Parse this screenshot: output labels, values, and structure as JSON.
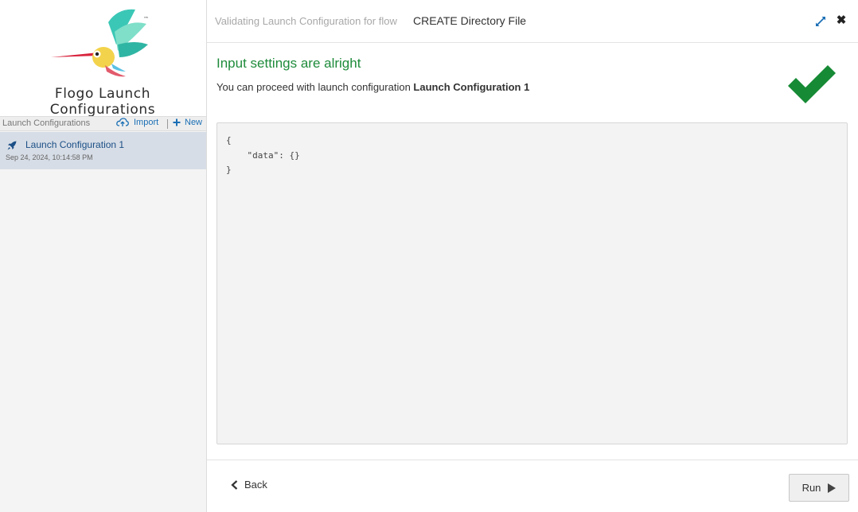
{
  "sidebar": {
    "app_title": "Flogo Launch Configurations",
    "list_header": "Launch Configurations",
    "import_label": "Import",
    "new_label": "New",
    "items": [
      {
        "name": "Launch Configuration 1",
        "date": "Sep 24, 2024, 10:14:58 PM",
        "icon": "rocket-icon"
      }
    ]
  },
  "header": {
    "prefix": "Validating Launch Configuration for flow",
    "flow_name": "CREATE Directory File"
  },
  "status": {
    "title": "Input settings are alright",
    "message_prefix": "You can proceed with launch configuration ",
    "config_name": "Launch Configuration 1"
  },
  "json_output": "{\n    \"data\": {}\n}",
  "footer": {
    "back_label": "Back",
    "run_label": "Run"
  },
  "colors": {
    "success": "#1e8b3b",
    "link": "#1b6fb5",
    "selected_item": "#d7dde6"
  }
}
